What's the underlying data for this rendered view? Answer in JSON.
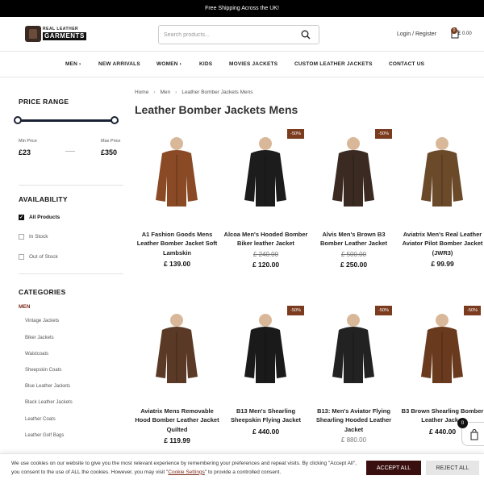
{
  "topbar": {
    "text": "Free Shipping Across the UK!"
  },
  "header": {
    "logo_line1": "REAL LEATHER",
    "logo_line2": "GARMENTS",
    "search_placeholder": "Search products...",
    "login_label": "Login / Register",
    "cart_count": "0",
    "cart_total": "£ 0.00"
  },
  "nav": {
    "men": "MEN ›",
    "new_arrivals": "NEW ARRIVALS",
    "women": "WOMEN ›",
    "kids": "KIDS",
    "movies": "MOVIES JACKETS",
    "custom": "CUSTOM LEATHER JACKETS",
    "contact": "CONTACT US"
  },
  "sidebar": {
    "price_title": "PRICE RANGE",
    "min_label": "Min Price",
    "max_label": "Max Price",
    "min_value": "£23",
    "max_value": "£350",
    "availability_title": "AVAILABILITY",
    "availability": [
      "All Products",
      "In Stock",
      "Out of Stock"
    ],
    "categories_title": "CATEGORIES",
    "men_label": "MEN",
    "subcategories": [
      "Vintage Jackets",
      "Biker Jackets",
      "Waistcoats",
      "Sheepskin Coats",
      "Blue Leather Jackets",
      "Black Leather Jackets",
      "Leather Coats",
      "Leather Golf Bags"
    ]
  },
  "breadcrumb": [
    "Home",
    "Men",
    "Leather Bomber Jackets Mens"
  ],
  "page_title": "Leather Bomber Jackets Mens",
  "products": [
    {
      "name": "A1 Fashion Goods Mens Leather Bomber Jacket Soft Lambskin",
      "old_price": "",
      "price": "£ 139.00",
      "badge": "",
      "color": "#8a4a26"
    },
    {
      "name": "Alcoa Men's Hooded Bomber Biker leather Jacket",
      "old_price": "£ 240.00",
      "price": "£ 120.00",
      "badge": "-50%",
      "color": "#1c1c1c"
    },
    {
      "name": "Alvis Men's Brown B3 Bomber Leather Jacket",
      "old_price": "£ 500.00",
      "price": "£ 250.00",
      "badge": "-50%",
      "color": "#3a2a22"
    },
    {
      "name": "Aviatrix Men's Real Leather Aviator Pilot Bomber Jacket (JWR3)",
      "old_price": "",
      "price": "£ 99.99",
      "badge": "",
      "color": "#6b4a2a"
    },
    {
      "name": "Aviatrix Mens Removable Hood Bomber Leather Jacket Quilted",
      "old_price": "",
      "price": "£ 119.99",
      "badge": "",
      "color": "#5a3a26"
    },
    {
      "name": "B13 Men's Shearling Sheepskin Flying Jacket",
      "old_price": "",
      "price": "£ 440.00",
      "badge": "-50%",
      "color": "#1a1a1a"
    },
    {
      "name": "B13: Men's Aviator Flying Shearling Hooded Leather Jacket",
      "old_price": "£ 880.00",
      "price": "",
      "badge": "-50%",
      "color": "#222222"
    },
    {
      "name": "B3 Brown Shearling Bomber Leather Jacket",
      "old_price": "",
      "price": "£ 440.00",
      "badge": "-50%",
      "color": "#6a3a1e"
    }
  ],
  "cookie": {
    "text_before": "We use cookies on our website to give you the most relevant experience by remembering your preferences and repeat visits. By clicking \"Accept All\", you consent to the use of ALL the cookies. However, you may visit \"",
    "link": "Cookie Settings",
    "text_after": "\" to provide a controlled consent.",
    "accept": "ACCEPT ALL",
    "reject": "REJECT ALL"
  },
  "float_cart": {
    "count": "0"
  },
  "colors": {
    "brand": "#7a3b1e",
    "accept_button": "#3a0f0f",
    "topbar": "#000000"
  }
}
